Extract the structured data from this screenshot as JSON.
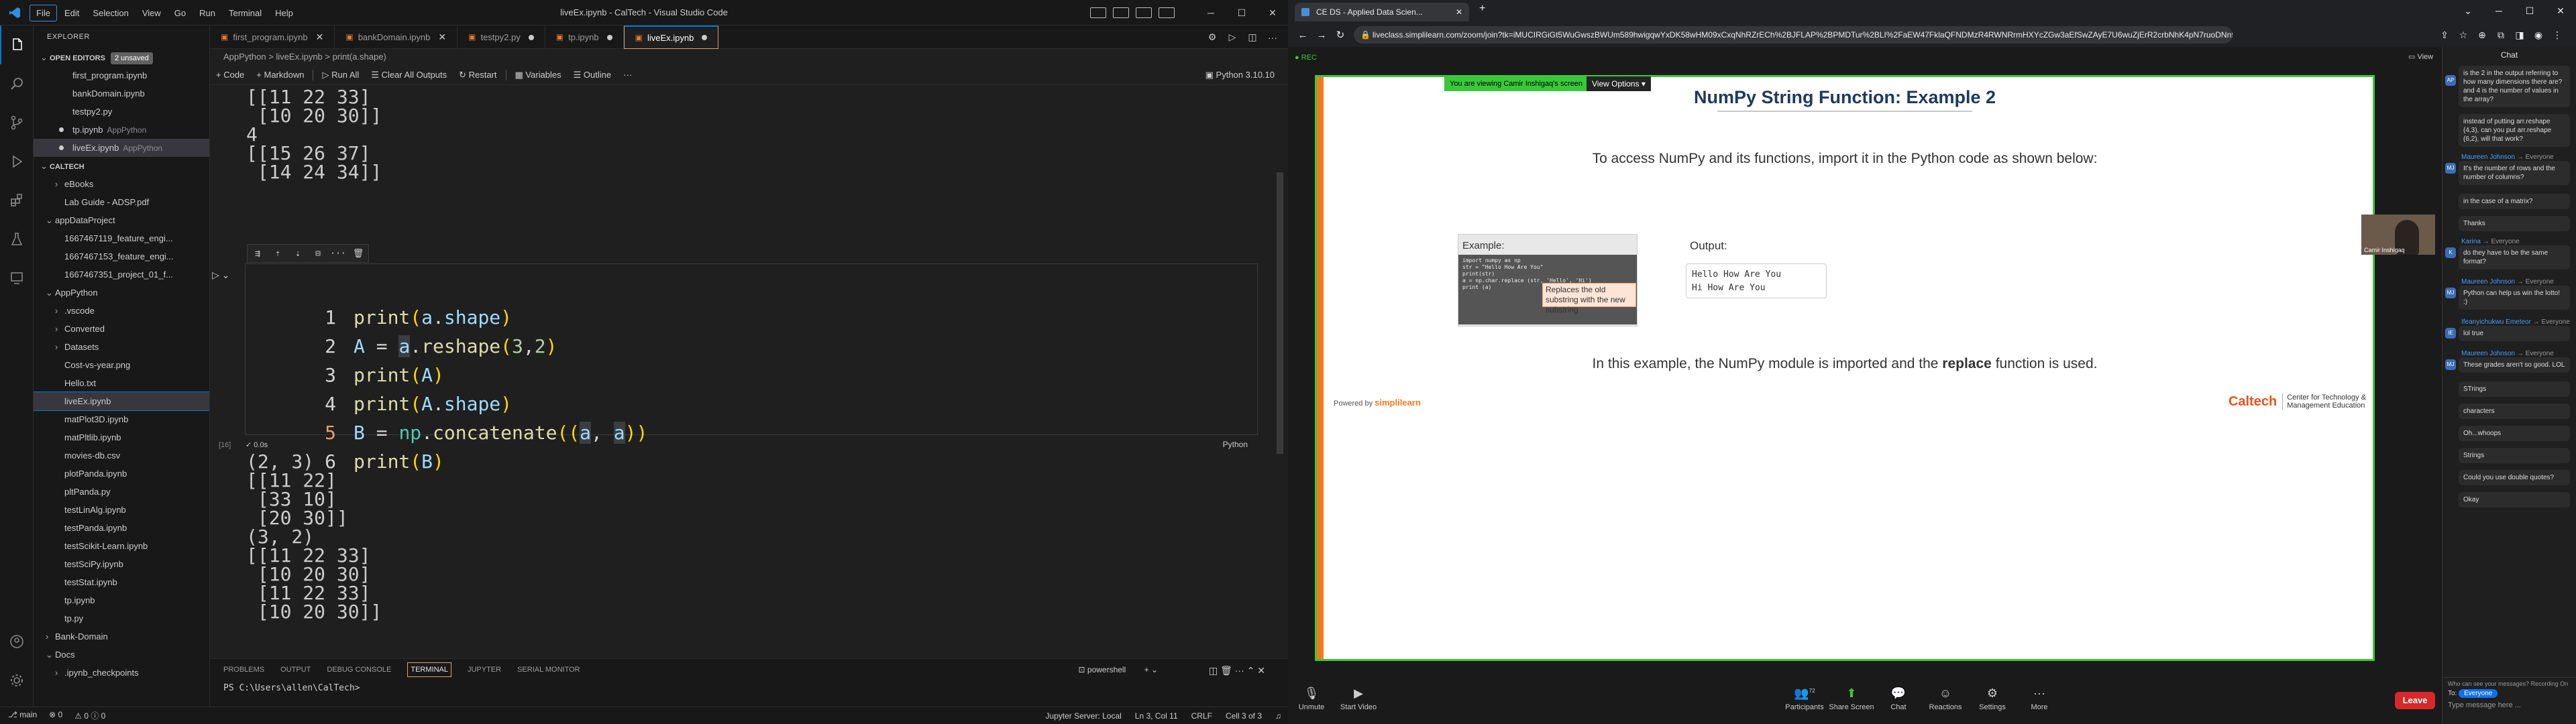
{
  "vscode": {
    "menu": [
      "File",
      "Edit",
      "Selection",
      "View",
      "Go",
      "Run",
      "Terminal",
      "Help"
    ],
    "window_title": "liveEx.ipynb - CalTech - Visual Studio Code",
    "explorer_title": "EXPLORER",
    "open_editors": {
      "label": "OPEN EDITORS",
      "badge": "2 unsaved"
    },
    "open_files": [
      {
        "name": "first_program.ipynb",
        "desc": ""
      },
      {
        "name": "bankDomain.ipynb",
        "desc": ""
      },
      {
        "name": "testpy2.py",
        "desc": ""
      },
      {
        "name": "tp.ipynb",
        "desc": "AppPython"
      },
      {
        "name": "liveEx.ipynb",
        "desc": "AppPython"
      }
    ],
    "workspace": "CALTECH",
    "tree": [
      {
        "name": "eBooks",
        "indent": 1,
        "type": "folder"
      },
      {
        "name": "Lab Guide - ADSP.pdf",
        "indent": 1,
        "type": "file"
      },
      {
        "name": "appDataProject",
        "indent": 0,
        "type": "folder-open"
      },
      {
        "name": "1667467119_feature_engi...",
        "indent": 1,
        "type": "file"
      },
      {
        "name": "1667467153_feature_engi...",
        "indent": 1,
        "type": "file"
      },
      {
        "name": "1667467351_project_01_f...",
        "indent": 1,
        "type": "file"
      },
      {
        "name": "AppPython",
        "indent": 0,
        "type": "folder-open"
      },
      {
        "name": ".vscode",
        "indent": 1,
        "type": "folder"
      },
      {
        "name": "Converted",
        "indent": 1,
        "type": "folder"
      },
      {
        "name": "Datasets",
        "indent": 1,
        "type": "folder"
      },
      {
        "name": "Cost-vs-year.png",
        "indent": 1,
        "type": "file"
      },
      {
        "name": "Hello.txt",
        "indent": 1,
        "type": "file"
      },
      {
        "name": "liveEx.ipynb",
        "indent": 1,
        "type": "file",
        "selected": true
      },
      {
        "name": "matPlot3D.ipynb",
        "indent": 1,
        "type": "file"
      },
      {
        "name": "matPltlib.ipynb",
        "indent": 1,
        "type": "file"
      },
      {
        "name": "movies-db.csv",
        "indent": 1,
        "type": "file"
      },
      {
        "name": "plotPanda.ipynb",
        "indent": 1,
        "type": "file"
      },
      {
        "name": "pltPanda.py",
        "indent": 1,
        "type": "file"
      },
      {
        "name": "testLinAlg.ipynb",
        "indent": 1,
        "type": "file"
      },
      {
        "name": "testPanda.ipynb",
        "indent": 1,
        "type": "file"
      },
      {
        "name": "testScikit-Learn.ipynb",
        "indent": 1,
        "type": "file"
      },
      {
        "name": "testSciPy.ipynb",
        "indent": 1,
        "type": "file"
      },
      {
        "name": "testStat.ipynb",
        "indent": 1,
        "type": "file"
      },
      {
        "name": "tp.ipynb",
        "indent": 1,
        "type": "file"
      },
      {
        "name": "tp.py",
        "indent": 1,
        "type": "file"
      },
      {
        "name": "Bank-Domain",
        "indent": 0,
        "type": "folder"
      },
      {
        "name": "Docs",
        "indent": 0,
        "type": "folder-open"
      },
      {
        "name": ".ipynb_checkpoints",
        "indent": 1,
        "type": "folder"
      }
    ],
    "tabs": [
      {
        "label": "first_program.ipynb",
        "state": "close"
      },
      {
        "label": "bankDomain.ipynb",
        "state": "close"
      },
      {
        "label": "testpy2.py",
        "state": "modified"
      },
      {
        "label": "tp.ipynb",
        "state": "modified"
      },
      {
        "label": "liveEx.ipynb",
        "state": "modified",
        "active": true
      }
    ],
    "breadcrumb": "AppPython  >  liveEx.ipynb  >  print(a.shape)",
    "toolbar": {
      "code": "+ Code",
      "markdown": "+ Markdown",
      "run_all": "▷ Run All",
      "clear": "☰ Clear All Outputs",
      "restart": "↻ Restart",
      "variables": "▦ Variables",
      "outline": "☰ Outline",
      "more": "···",
      "kernel": "▣ Python 3.10.10"
    },
    "output_top": "[[11 22 33]\n [10 20 30]]\n4\n[[15 26 37]\n [14 24 34]]",
    "cell_lang": "Python",
    "cell_exec": "[16]",
    "cell_time": "0.0s",
    "output_bottom": "(2, 3)\n[[11 22]\n [33 10]\n [20 30]]\n(3, 2)\n[[11 22 33]\n [10 20 30]\n [11 22 33]\n [10 20 30]]",
    "panel_tabs": [
      "PROBLEMS",
      "OUTPUT",
      "DEBUG CONSOLE",
      "TERMINAL",
      "JUPYTER",
      "SERIAL MONITOR"
    ],
    "terminal_shell": "powershell",
    "prompt": "PS C:\\Users\\allen\\CalTech>",
    "status_left": [
      "⎇ main",
      "⊗ 0",
      "⚠ 0  ⓘ 0"
    ],
    "status_right": [
      "Jupyter Server: Local",
      "Ln 3, Col 11",
      "CRLF",
      "Cell 3 of 3",
      "♫"
    ]
  },
  "browser": {
    "tab_title": "CE DS - Applied Data Scien...",
    "url": "liveclass.simplilearn.com/zoom/join?tk=iMUCIRGiGt5WuGwszBWUm589hwigqwYxDK58wHM09xCxqNhRZrECh%2BJFLAP%2BPMDTur%2BLI%2FaEW47FklaQFNDMzR4RWNRrmHXYcZGw3aEfSwZAyE7U6wuZjErR2crbNhK4pN7ruoDNn5pox5OyIi...",
    "rec": "● REC",
    "view_btn": "▭ View",
    "viewing_text": "You are viewing Camir Inshigaq's screen",
    "view_options": "View Options ▾",
    "cam_name": "Camir Inshigaq",
    "slide": {
      "title": "NumPy String Function: Example 2",
      "intro": "To access NumPy and its functions, import it in the Python code as shown below:",
      "example_label": "Example:",
      "code": "import numpy as np\nstr = \"Hello How Are You\"\nprint(str)\na = np.char.replace (str, 'Hello', 'Hi')\nprint (a)",
      "callout": "Replaces the old substring with the new substring",
      "output_label": "Output:",
      "output": "Hello How Are You\nHi How Are You",
      "bottom_pre": "In this example, the NumPy module is imported and the ",
      "bottom_bold": "replace",
      "bottom_post": " function is used.",
      "powered": "Powered by",
      "brand": "simplilearn",
      "caltech": "Caltech",
      "ctme": "Center for Technology &\nManagement Education"
    },
    "zoom_bar": {
      "unmute": "Unmute",
      "video": "Start Video",
      "participants": "Participants",
      "participants_count": "72",
      "share": "Share Screen",
      "chat": "Chat",
      "reactions": "Reactions",
      "settings": "Settings",
      "more": "More",
      "leave": "Leave"
    },
    "chat": {
      "title": "Chat",
      "messages": [
        {
          "sender": "",
          "to": "",
          "text": "is the 2 in the output referring to how many dimensions there are? and 4 is the number of values in the array?",
          "avatar": "AP"
        },
        {
          "sender": "",
          "to": "",
          "text": "instead of putting arr.reshape (4,3), can you put arr.reshape (6,2), will that work?",
          "avatar": ""
        },
        {
          "sender": "Maureen Johnson",
          "to": "Everyone",
          "text": "It's the number of rows and the number of columns?",
          "avatar": "MJ"
        },
        {
          "sender": "",
          "to": "",
          "text": "in the case of a matrix?",
          "avatar": ""
        },
        {
          "sender": "",
          "to": "",
          "text": "Thanks",
          "avatar": ""
        },
        {
          "sender": "Karina",
          "to": "Everyone",
          "text": "do they have to be the same format?",
          "avatar": "K"
        },
        {
          "sender": "Maureen Johnson",
          "to": "Everyone",
          "text": "Python can help us win the lotto! :)",
          "avatar": "MJ"
        },
        {
          "sender": "Ifeanyichukwu Emeteor",
          "to": "Everyone",
          "text": "lol true",
          "avatar": "IE"
        },
        {
          "sender": "Maureen Johnson",
          "to": "Everyone",
          "text": "These grades aren't so good. LOL",
          "avatar": "MJ"
        },
        {
          "sender": "",
          "to": "",
          "text": "STrings",
          "avatar": ""
        },
        {
          "sender": "",
          "to": "",
          "text": "characters",
          "avatar": ""
        },
        {
          "sender": "",
          "to": "",
          "text": "Oh...whoops",
          "avatar": ""
        },
        {
          "sender": "",
          "to": "",
          "text": "Strings",
          "avatar": ""
        },
        {
          "sender": "",
          "to": "",
          "text": "Could you use double quotes?",
          "avatar": ""
        },
        {
          "sender": "",
          "to": "",
          "text": "Okay",
          "avatar": ""
        }
      ],
      "who_can_see": "Who can see your messages? Recording On",
      "to_label": "To:",
      "to_value": "Everyone",
      "placeholder": "Type message here ..."
    }
  }
}
